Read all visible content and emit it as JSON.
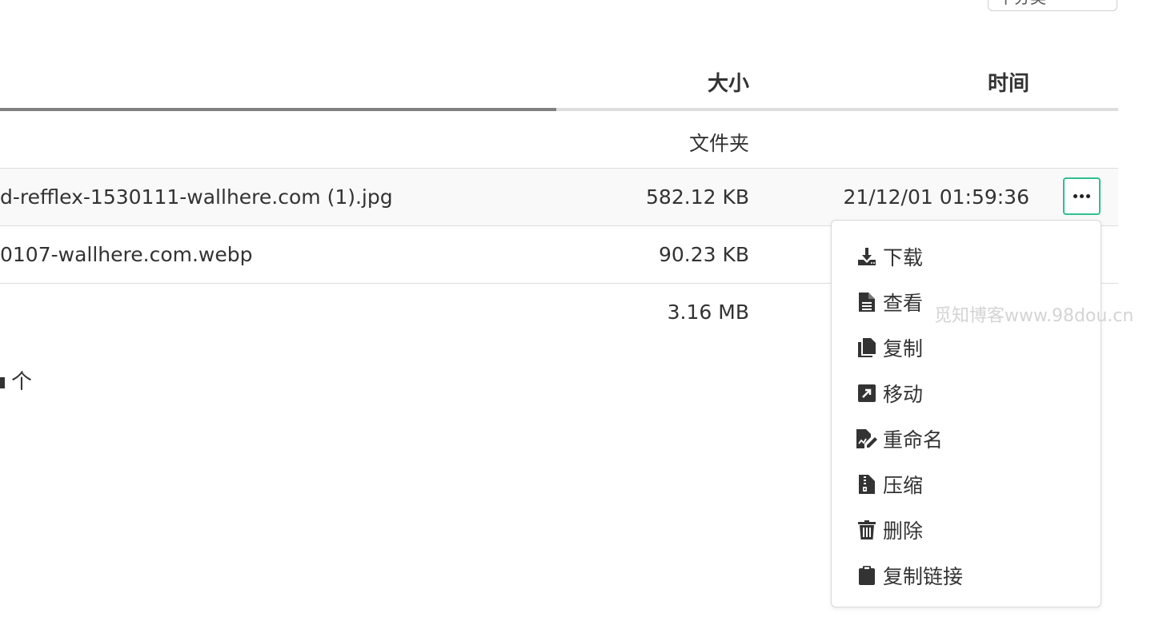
{
  "top_select": {
    "label": "下分类"
  },
  "table": {
    "headers": {
      "size": "大小",
      "time": "时间"
    },
    "rows": [
      {
        "name": "",
        "size": "文件夹",
        "time": ""
      },
      {
        "name": "d-refflex-1530111-wallhere.com (1).jpg",
        "size": "582.12 KB",
        "time": "21/12/01 01:59:36"
      },
      {
        "name": "0107-wallhere.com.webp",
        "size": "90.23 KB",
        "time": ""
      },
      {
        "name": "",
        "size": "3.16 MB",
        "time": ""
      }
    ]
  },
  "summary": {
    "count_text": "个"
  },
  "menu": {
    "items": [
      {
        "label": "下载",
        "icon": "download-icon"
      },
      {
        "label": "查看",
        "icon": "file-icon"
      },
      {
        "label": "复制",
        "icon": "copy-icon"
      },
      {
        "label": "移动",
        "icon": "move-icon"
      },
      {
        "label": "重命名",
        "icon": "rename-icon"
      },
      {
        "label": "压缩",
        "icon": "archive-icon"
      },
      {
        "label": "删除",
        "icon": "trash-icon"
      },
      {
        "label": "复制链接",
        "icon": "clipboard-icon"
      }
    ]
  },
  "watermark": "觅知博客www.98dou.cn",
  "colors": {
    "accent": "#2fbf8f",
    "header_underline": "#808080"
  }
}
